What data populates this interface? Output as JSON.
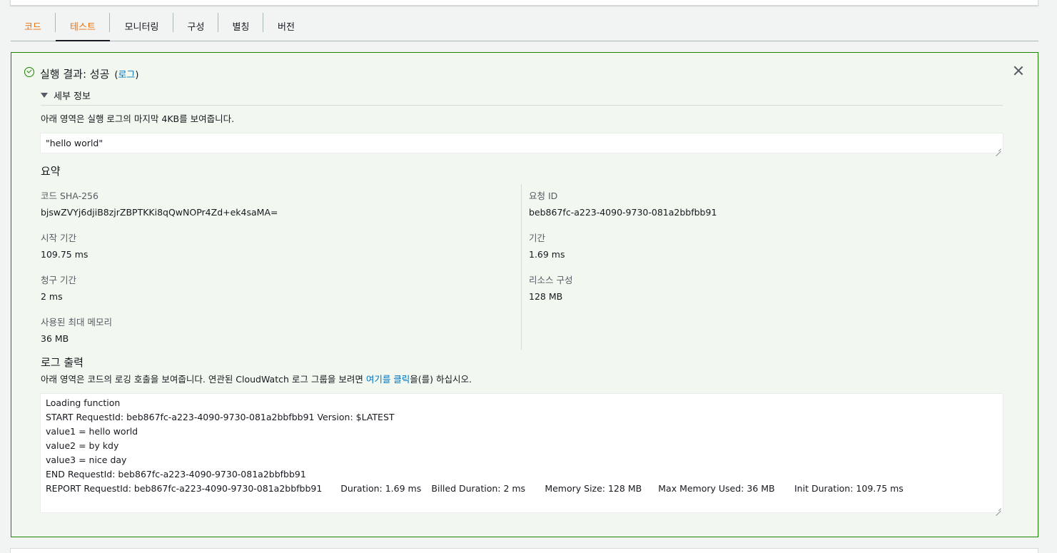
{
  "tabs": [
    {
      "label": "코드"
    },
    {
      "label": "테스트"
    },
    {
      "label": "모니터링"
    },
    {
      "label": "구성"
    },
    {
      "label": "별칭"
    },
    {
      "label": "버전"
    }
  ],
  "result": {
    "title": "실행 결과: 성공",
    "log_open": "(",
    "log_link": "로그",
    "log_close": ")",
    "details_label": "세부 정보",
    "tail_note": "아래 영역은 실행 로그의 마지막 4KB를 보여줍니다.",
    "output_value": "\"hello world\""
  },
  "summary": {
    "title": "요약",
    "code_sha_label": "코드 SHA-256",
    "code_sha_value": "bjswZVYj6djiB8zjrZBPTKKi8qQwNOPr4Zd+ek4saMA=",
    "request_id_label": "요청 ID",
    "request_id_value": "beb867fc-a223-4090-9730-081a2bbfbb91",
    "init_label": "시작 기간",
    "init_value": "109.75 ms",
    "duration_label": "기간",
    "duration_value": "1.69 ms",
    "billed_label": "청구 기간",
    "billed_value": "2 ms",
    "resources_label": "리소스 구성",
    "resources_value": "128 MB",
    "max_memory_label": "사용된 최대 메모리",
    "max_memory_value": "36 MB"
  },
  "log_output": {
    "title": "로그 출력",
    "desc_before": "아래 영역은 코드의 로깅 호출을 보여줍니다. 연관된 CloudWatch 로그 그룹을 보려면 ",
    "desc_link": "여기를 클릭",
    "desc_after": "을(를) 하십시오.",
    "lines": [
      "Loading function",
      "START RequestId: beb867fc-a223-4090-9730-081a2bbfbb91 Version: $LATEST",
      "value1 = hello world",
      "value2 = by kdy",
      "value3 = nice day",
      "END RequestId: beb867fc-a223-4090-9730-081a2bbfbb91",
      "REPORT RequestId: beb867fc-a223-4090-9730-081a2bbfbb91\tDuration: 1.69 ms\tBilled Duration: 2 ms\tMemory Size: 128 MB\tMax Memory Used: 36 MB\tInit Duration: 109.75 ms"
    ]
  },
  "colors": {
    "accent": "#ec7211",
    "success": "#1d8102",
    "link": "#0073bb"
  },
  "icons": [
    "check-circle-icon",
    "close-icon",
    "caret-down-icon",
    "resize-handle-icon"
  ]
}
